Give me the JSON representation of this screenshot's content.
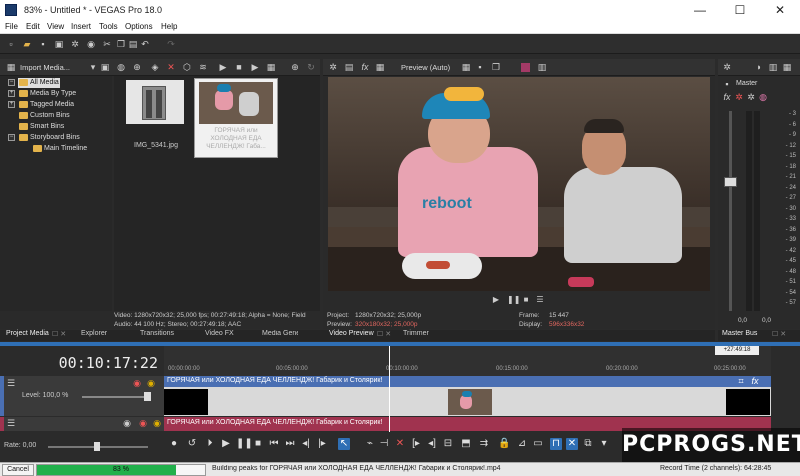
{
  "window": {
    "title": "83% - Untitled * - VEGAS Pro 18.0",
    "minimize": "—",
    "maximize": "☐",
    "close": "✕"
  },
  "menu": [
    "File",
    "Edit",
    "View",
    "Insert",
    "Tools",
    "Options",
    "Help"
  ],
  "project_media": {
    "import_label": "Import Media...",
    "tree": [
      "All Media",
      "Media By Type",
      "Tagged Media",
      "Custom Bins",
      "Smart Bins",
      "Storyboard Bins",
      "Main Timeline"
    ],
    "thumbs": [
      {
        "name": "IMG_5341.jpg"
      },
      {
        "name": "ГОРЯЧАЯ или ХОЛОДНАЯ ЕДА ЧЕЛЛЕНДЖ! Габа..."
      }
    ],
    "info_video": "Video: 1280x720x32; 25,000 fps; 00:27:49:18; Alpha = None; Field",
    "info_audio": "Audio: 44 100 Hz; Stereo; 00:27:49:18; AAC"
  },
  "bottom_tabs": [
    "Project Media",
    "Explorer",
    "Transitions",
    "Video FX",
    "Media Generators"
  ],
  "preview": {
    "mode_label": "Preview (Auto)",
    "project_label": "Project:",
    "project_value": "1280x720x32; 25,000p",
    "preview_label": "Preview:",
    "preview_value": "320x180x32; 25,000p",
    "frame_label": "Frame:",
    "frame_value": "15 447",
    "display_label": "Display:",
    "display_value": "596x336x32",
    "tabs": [
      "Video Preview",
      "Trimmer"
    ],
    "scene": {
      "cap_text": "",
      "shirt_text": "reboot"
    }
  },
  "master": {
    "label": "Master",
    "bus_tab": "Master Bus",
    "scale": [
      "3",
      "6",
      "9",
      "12",
      "15",
      "18",
      "21",
      "24",
      "27",
      "30",
      "33",
      "36",
      "39",
      "42",
      "45",
      "48",
      "51",
      "54",
      "57"
    ],
    "level_left": "0,0",
    "level_right": "0,0"
  },
  "timeline": {
    "timecode": "00:10:17:22",
    "ruler_marker": "+27:49:18",
    "ruler": [
      "00:00:00:00",
      "00:05:00:00",
      "00:10:00:00",
      "00:15:00:00",
      "00:20:00:00",
      "00:25:00:00"
    ],
    "video_track": {
      "level_label": "Level: 100,0 %",
      "clip_title": "ГОРЯЧАЯ или ХОЛОДНАЯ ЕДА ЧЕЛЛЕНДЖ! Габарик и Столярик!"
    },
    "audio_track": {
      "clip_title": "ГОРЯЧАЯ или ХОЛОДНАЯ ЕДА ЧЕЛЛЕНДЖ! Габарик и Столярик!"
    },
    "rate_label": "Rate: 0,00",
    "playhead_fraction": 0.37
  },
  "status": {
    "cancel_label": "Cancel",
    "progress_text": "83 %",
    "progress": 0.83,
    "message": "Building peaks for ГОРЯЧАЯ или ХОЛОДНАЯ ЕДА ЧЕЛЛЕНДЖ! Габарик и Столярик!.mp4",
    "record_time": "Record Time (2 channels): 64:28:45"
  },
  "watermark": "PCPROGS.NET",
  "colors": {
    "video_track": "#4a6fb3",
    "audio_track": "#a0334f",
    "progress": "#21b04b",
    "accent": "#2f6fb5"
  }
}
